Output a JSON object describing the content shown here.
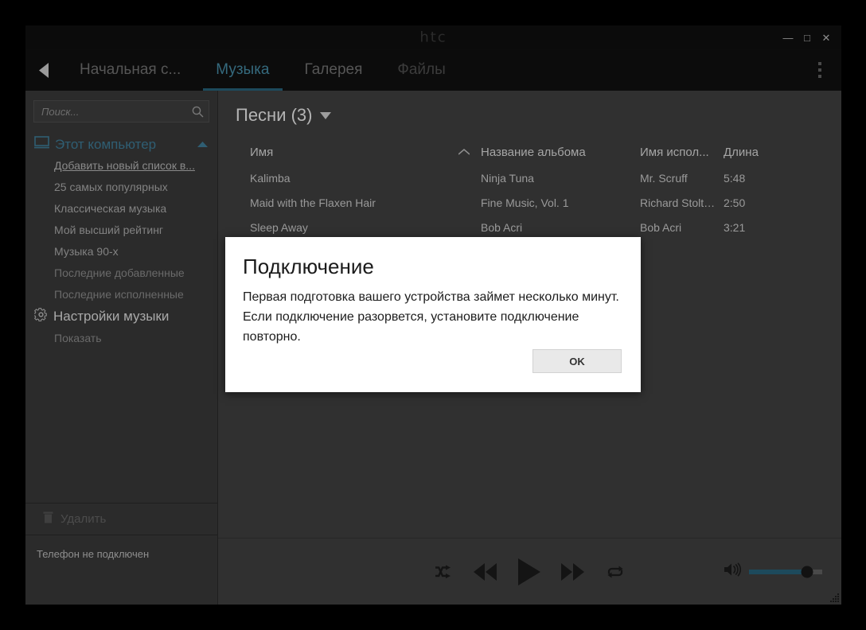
{
  "window": {
    "brand": "htc",
    "controls": {
      "minimize": "—",
      "maximize": "□",
      "close": "✕"
    }
  },
  "tabs": [
    {
      "label": "Начальная с...",
      "state": "inactive"
    },
    {
      "label": "Музыка",
      "state": "active"
    },
    {
      "label": "Галерея",
      "state": "inactive"
    },
    {
      "label": "Файлы",
      "state": "dim"
    }
  ],
  "sidebar": {
    "search": {
      "placeholder": "Поиск...",
      "value": "",
      "icon": "search-icon"
    },
    "computer_group": {
      "label": "Этот компьютер",
      "icon": "monitor-icon",
      "collapse_icon": "chevron-up-icon"
    },
    "playlists": [
      {
        "label": "Добавить новый список в...",
        "style": "link"
      },
      {
        "label": "25 самых популярных",
        "style": "normal"
      },
      {
        "label": "Классическая музыка",
        "style": "normal"
      },
      {
        "label": "Мой высший рейтинг",
        "style": "normal"
      },
      {
        "label": "Музыка 90-х",
        "style": "normal"
      },
      {
        "label": "Последние добавленные",
        "style": "dim"
      },
      {
        "label": "Последние исполненные",
        "style": "dim"
      }
    ],
    "settings_group": {
      "label": "Настройки музыки",
      "icon": "gear-icon"
    },
    "settings_items": [
      {
        "label": "Показать",
        "style": "dim"
      }
    ],
    "delete_button": {
      "label": "Удалить",
      "icon": "trash-icon"
    },
    "status": "Телефон не подключен"
  },
  "main": {
    "heading": "Песни (3)",
    "heading_caret": "caret-down-icon",
    "columns": {
      "name": "Имя",
      "album": "Название альбома",
      "artist": "Имя испол...",
      "length": "Длина",
      "sort_icon": "sort-ascending-icon"
    },
    "rows": [
      {
        "name": "Kalimba",
        "album": "Ninja Tuna",
        "artist": "Mr. Scruff",
        "length": "5:48"
      },
      {
        "name": "Maid with the Flaxen Hair",
        "album": "Fine Music, Vol. 1",
        "artist": "Richard Stoltzma...",
        "length": "2:50"
      },
      {
        "name": "Sleep Away",
        "album": "Bob Acri",
        "artist": "Bob Acri",
        "length": "3:21"
      }
    ]
  },
  "player": {
    "shuffle_icon": "shuffle-icon",
    "previous_icon": "rewind-icon",
    "play_icon": "play-icon",
    "next_icon": "fast-forward-icon",
    "repeat_icon": "repeat-icon",
    "volume_icon": "volume-icon",
    "volume_percent": 79
  },
  "modal": {
    "title": "Подключение",
    "message": "Первая подготовка вашего устройства займет несколько минут. Если подключение разорвется, установите подключение повторно.",
    "ok_label": "OK"
  },
  "colors": {
    "accent_teal": "#2f5e73",
    "tab_active": "#356a7e",
    "tab_underline": "#1d4a5c",
    "window_bg": "#2e2e2e",
    "sidebar_bg": "#2b2b2b",
    "content_bg": "#303030",
    "titlebar_bg": "#0b0b0b",
    "modal_bg": "#ffffff"
  }
}
